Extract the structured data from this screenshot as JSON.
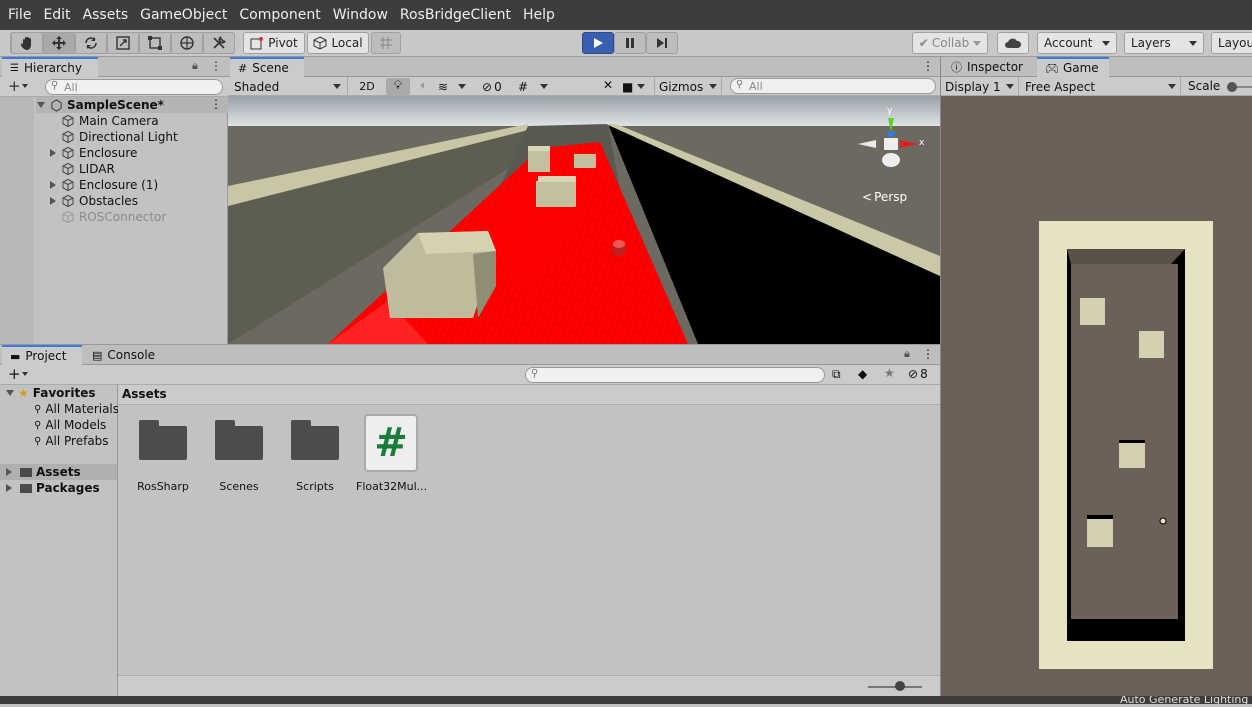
{
  "menubar": {
    "items": [
      "File",
      "Edit",
      "Assets",
      "GameObject",
      "Component",
      "Window",
      "RosBridgeClient",
      "Help"
    ]
  },
  "toolbar": {
    "tools": [
      "hand-tool",
      "move-tool",
      "rotate-tool",
      "scale-tool",
      "rect-tool",
      "transform-tool",
      "custom-tool"
    ],
    "pivot_label": "Pivot",
    "local_label": "Local",
    "collab_label": "Collab",
    "account_label": "Account",
    "layers_label": "Layers",
    "layout_label": "Layou"
  },
  "hierarchy": {
    "tab_label": "Hierarchy",
    "search_placeholder": "All",
    "scene_name": "SampleScene*",
    "items": [
      {
        "label": "Main Camera",
        "expandable": false,
        "disabled": false
      },
      {
        "label": "Directional Light",
        "expandable": false,
        "disabled": false
      },
      {
        "label": "Enclosure",
        "expandable": true,
        "disabled": false
      },
      {
        "label": "LIDAR",
        "expandable": false,
        "disabled": false
      },
      {
        "label": "Enclosure (1)",
        "expandable": true,
        "disabled": false
      },
      {
        "label": "Obstacles",
        "expandable": true,
        "disabled": false
      },
      {
        "label": "ROSConnector",
        "expandable": false,
        "disabled": true
      }
    ]
  },
  "scene": {
    "tab_label": "Scene",
    "shading_mode": "Shaded",
    "mode_2d": "2D",
    "hidden_count": "0",
    "gizmos_label": "Gizmos",
    "search_placeholder": "All",
    "persp_label": "Persp",
    "axis_y": "y",
    "axis_x": "x"
  },
  "project": {
    "tab_project": "Project",
    "tab_console": "Console",
    "hidden_count": "8",
    "favorites_label": "Favorites",
    "favorites": [
      "All Materials",
      "All Models",
      "All Prefabs"
    ],
    "roots": [
      "Assets",
      "Packages"
    ],
    "breadcrumb": "Assets",
    "assets": [
      {
        "name": "RosSharp",
        "type": "folder"
      },
      {
        "name": "Scenes",
        "type": "folder"
      },
      {
        "name": "Scripts",
        "type": "folder"
      },
      {
        "name": "Float32Mul...",
        "type": "script"
      }
    ],
    "script_glyph": "#"
  },
  "inspector": {
    "tab_inspector": "Inspector",
    "tab_game": "Game",
    "display_label": "Display 1",
    "aspect_label": "Free Aspect",
    "scale_label": "Scale"
  },
  "statusbar": {
    "text": "Auto Generate Lighting"
  },
  "colors": {
    "menubar_bg": "#3d3d3d",
    "play_active": "#3a5eb0",
    "lidar_red": "#ff0000",
    "game_bg": "#6b6158",
    "wall": "#e6e3c2"
  }
}
